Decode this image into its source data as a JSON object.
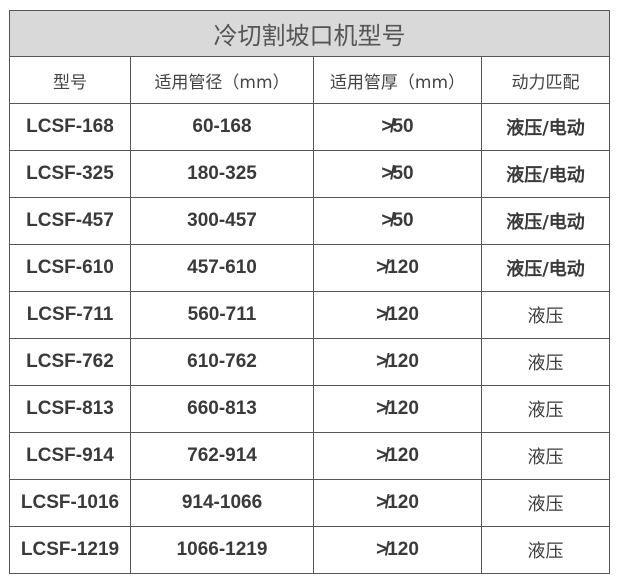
{
  "table": {
    "title": "冷切割坡口机型号",
    "headers": [
      "型号",
      "适用管径（mm）",
      "适用管厚（mm）",
      "动力匹配"
    ],
    "rows": [
      [
        "LCSF-168",
        "60-168",
        "≯50",
        "液压/电动"
      ],
      [
        "LCSF-325",
        "180-325",
        "≯50",
        "液压/电动"
      ],
      [
        "LCSF-457",
        "300-457",
        "≯50",
        "液压/电动"
      ],
      [
        "LCSF-610",
        "457-610",
        "≯120",
        "液压/电动"
      ],
      [
        "LCSF-711",
        "560-711",
        "≯120",
        "液压"
      ],
      [
        "LCSF-762",
        "610-762",
        "≯120",
        "液压"
      ],
      [
        "LCSF-813",
        "660-813",
        "≯120",
        "液压"
      ],
      [
        "LCSF-914",
        "762-914",
        "≯120",
        "液压"
      ],
      [
        "LCSF-1016",
        "914-1066",
        "≯120",
        "液压"
      ],
      [
        "LCSF-1219",
        "1066-1219",
        "≯120",
        "液压"
      ]
    ]
  },
  "colors": {
    "title_background": "#d9d9d9",
    "border": "#555555",
    "text": "#333333"
  }
}
